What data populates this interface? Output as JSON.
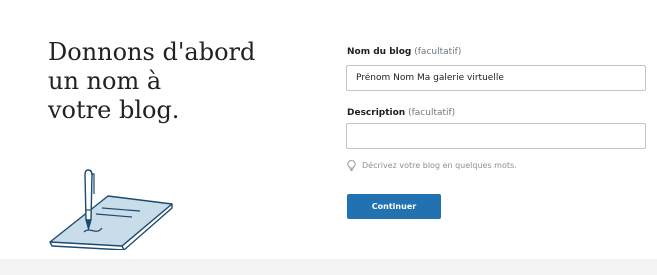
{
  "headline": {
    "line1": "Donnons d'abord",
    "line2": "un nom à",
    "line3": "votre blog."
  },
  "illustration": {
    "icon": "pen-writing-on-paper-icon"
  },
  "blog_name_field": {
    "label": "Nom du blog",
    "optional": "(facultatif)",
    "value": "Prénom Nom Ma galerie virtuelle"
  },
  "description_field": {
    "label": "Description",
    "optional": "(facultatif)",
    "value": ""
  },
  "hint": {
    "icon": "lightbulb-icon",
    "text": "Décrivez votre blog en quelques mots."
  },
  "continue_button": {
    "label": "Continuer"
  },
  "colors": {
    "accent": "#2271b1",
    "illustration_stroke": "#1d4a6e",
    "illustration_fill": "#c9dce9"
  }
}
